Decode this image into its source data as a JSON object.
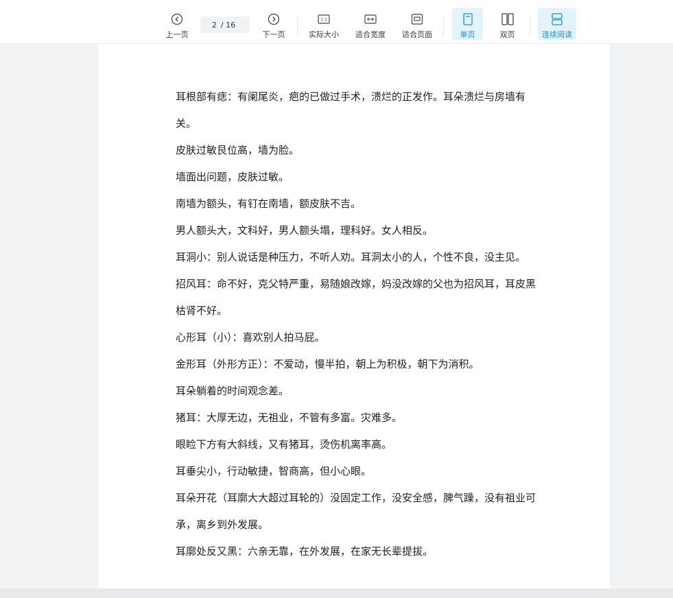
{
  "toolbar": {
    "prev": "上一页",
    "page_current": "2",
    "page_total": "/ 16",
    "next": "下一页",
    "actual_size": "实际大小",
    "fit_width": "适合宽度",
    "fit_page": "适合页面",
    "single_page": "单页",
    "double_page": "双页",
    "continuous": "连续阅读",
    "accent": "#1890d0"
  },
  "document": {
    "paragraphs": [
      "耳根部有痣：有阑尾炎，疤的已做过手术，溃烂的正发作。耳朵溃烂与房墙有关。",
      "皮肤过敏艮位高，墙为脸。",
      "墙面出问题，皮肤过敏。",
      "南墙为额头，有钉在南墙，额皮肤不吉。",
      "男人额头大，文科好，男人额头塌，理科好。女人相反。",
      "耳洞小：别人说话是种压力，不听人劝。耳洞太小的人，个性不良，没主见。",
      "招风耳：命不好，克父特严重，易随娘改嫁，妈没改嫁的父也为招风耳，耳皮黑枯肾不好。",
      "心形耳（小）：喜欢别人拍马屁。",
      "金形耳（外形方正）：不爱动，慢半拍，朝上为积极，朝下为消积。",
      "耳朵躺着的时间观念差。",
      "猪耳：大厚无边，无祖业，不管有多富。灾难多。",
      "眼睑下方有大斜线，又有猪耳，烫伤机离率高。",
      "耳垂尖小，行动敏捷，智商高，但小心眼。",
      "耳朵开花（耳廓大大超过耳轮的）没固定工作，没安全感，脾气躁，没有祖业可承，离乡到外发展。",
      "耳廓处反又黑：六亲无靠，在外发展，在家无长辈提拔。"
    ]
  }
}
